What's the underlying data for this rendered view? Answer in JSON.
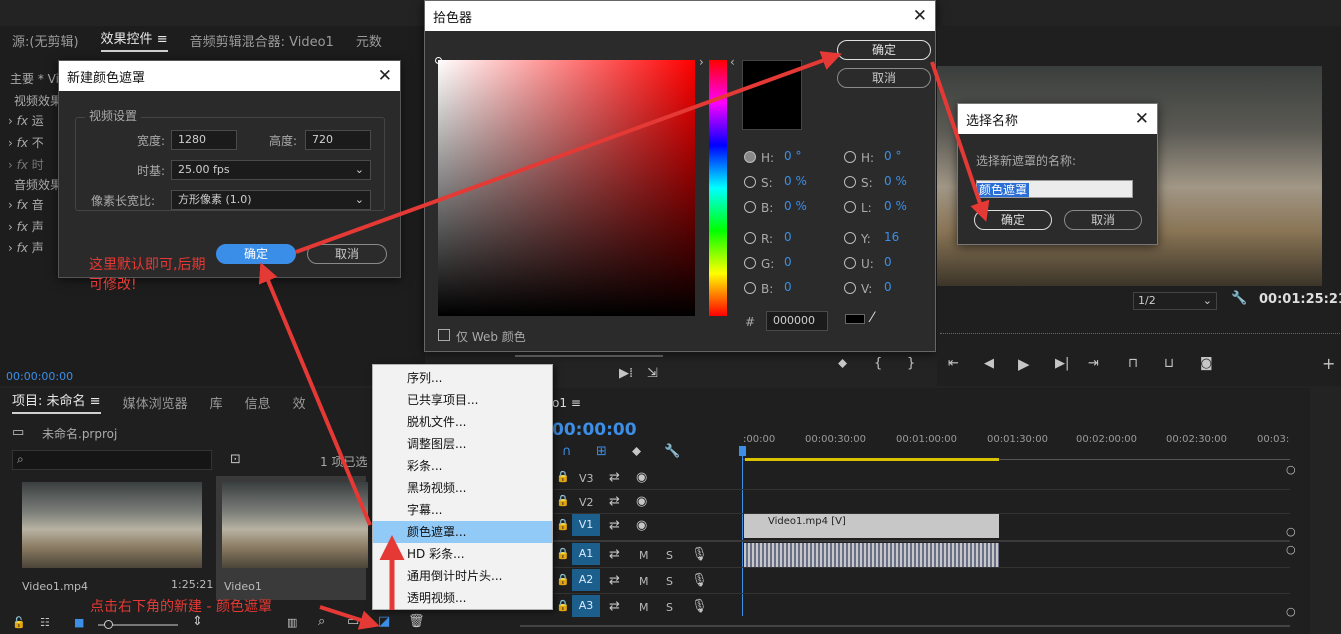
{
  "source_panel": {
    "tabs": [
      "源:(无剪辑)",
      "效果控件",
      "音频剪辑混合器: Video1",
      "元数"
    ],
    "menu_icon": "hamburger-icon",
    "master_label": "主要 * Vi",
    "video_effects": "视频效果",
    "audio_effects": "音频效果",
    "effect_rows": [
      "运",
      "不",
      "时",
      "音",
      "声",
      "声"
    ],
    "timecode": "00:00:00:00"
  },
  "new_color_matte_dialog": {
    "title": "新建颜色遮罩",
    "group": "视频设置",
    "width_label": "宽度:",
    "width_value": "1280",
    "height_label": "高度:",
    "height_value": "720",
    "timebase_label": "时基:",
    "timebase_value": "25.00 fps",
    "pixel_aspect_label": "像素长宽比:",
    "pixel_aspect_value": "方形像素 (1.0)",
    "ok": "确定",
    "cancel": "取消"
  },
  "color_picker": {
    "title": "拾色器",
    "ok": "确定",
    "cancel": "取消",
    "hsb": {
      "h_label": "H:",
      "h": "0 °",
      "s_label": "S:",
      "s": "0 %",
      "b_label": "B:",
      "b": "0 %"
    },
    "hsl": {
      "h_label": "H:",
      "h": "0 °",
      "s_label": "S:",
      "s": "0 %",
      "l_label": "L:",
      "l": "0 %"
    },
    "rgb": {
      "r_label": "R:",
      "r": "0",
      "g_label": "G:",
      "g": "0",
      "b_label": "B:",
      "b": "0"
    },
    "yuv": {
      "y_label": "Y:",
      "y": "16",
      "u_label": "U:",
      "u": "0",
      "v_label": "V:",
      "v": "0"
    },
    "hash": "#",
    "hex": "000000",
    "web_only": "仅 Web 颜色",
    "selected_color": "#000000"
  },
  "choose_name_dialog": {
    "title": "选择名称",
    "prompt": "选择新遮罩的名称:",
    "name_value": "颜色遮罩",
    "ok": "确定",
    "cancel": "取消"
  },
  "program_monitor": {
    "zoom": "1/2",
    "timecode": "00:01:25:21"
  },
  "project_panel": {
    "tabs": [
      "项目: 未命名",
      "媒体浏览器",
      "库",
      "信息",
      "效"
    ],
    "project_file": "未命名.prproj",
    "selected_count": "1 项已选",
    "clip1_name": "Video1.mp4",
    "clip1_duration": "1:25:21",
    "clip2_name": "Video1"
  },
  "new_item_menu": {
    "items": [
      "序列...",
      "已共享项目...",
      "脱机文件...",
      "调整图层...",
      "彩条...",
      "黑场视频...",
      "字幕...",
      "颜色遮罩...",
      "HD 彩条...",
      "通用倒计时片头...",
      "透明视频..."
    ],
    "highlighted": "颜色遮罩..."
  },
  "timeline": {
    "sequence_name": "o1",
    "timecode": "00:00:00",
    "ruler": [
      ":00:00",
      "00:00:30:00",
      "00:01:00:00",
      "00:01:30:00",
      "00:02:00:00",
      "00:02:30:00",
      "00:03:"
    ],
    "tracks": [
      "V3",
      "V2",
      "V1",
      "A1",
      "A2",
      "A3"
    ],
    "video_clip": "Video1.mp4 [V]",
    "m_label": "M",
    "s_label": "S"
  },
  "annotations": {
    "note1_line1": "这里默认即可,后期",
    "note1_line2": "可修改!",
    "note2": "点击右下角的新建 - 颜色遮罩"
  },
  "colors": {
    "accent": "#3b8ee8",
    "annotation": "#e53935",
    "menu_highlight": "#91c9f7"
  }
}
